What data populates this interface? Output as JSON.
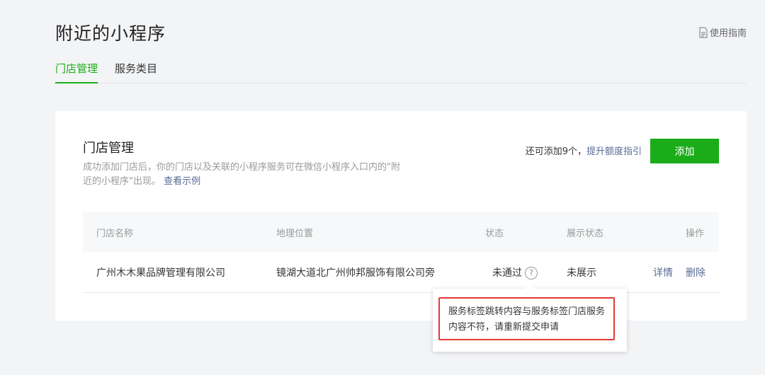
{
  "page": {
    "title": "附近的小程序",
    "guide_label": "使用指南"
  },
  "tabs": [
    {
      "label": "门店管理",
      "active": true
    },
    {
      "label": "服务类目",
      "active": false
    }
  ],
  "card": {
    "title": "门店管理",
    "desc": "成功添加门店后，你的门店以及关联的小程序服务可在微信小程序入口内的\"附近的小程序\"出现。",
    "desc_link": "查看示例",
    "quota_text": "还可添加9个，",
    "quota_link": "提升额度指引",
    "add_button": "添加"
  },
  "table": {
    "headers": {
      "name": "门店名称",
      "location": "地理位置",
      "status": "状态",
      "display": "展示状态",
      "ops": "操作"
    },
    "rows": [
      {
        "name": "广州木木果品牌管理有限公司",
        "location": "镜湖大道北广州帅邦服饰有限公司旁",
        "status": "未通过",
        "display": "未展示",
        "op_detail": "详情",
        "op_delete": "删除"
      }
    ]
  },
  "tooltip": {
    "text": "服务标签跳转内容与服务标签门店服务内容不符，请重新提交申请"
  },
  "colors": {
    "accent": "#1aad19",
    "link": "#576b95",
    "highlight": "#e53935"
  }
}
